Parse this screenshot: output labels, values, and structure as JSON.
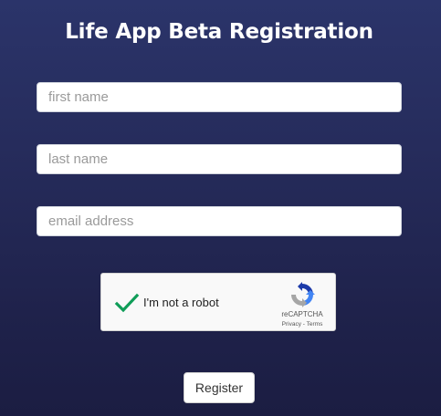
{
  "page": {
    "title": "Life App Beta Registration"
  },
  "form": {
    "first_name": {
      "value": "",
      "placeholder": "first name"
    },
    "last_name": {
      "value": "",
      "placeholder": "last name"
    },
    "email": {
      "value": "",
      "placeholder": "email address"
    },
    "register_label": "Register"
  },
  "captcha": {
    "label": "I'm not a robot",
    "checked": true,
    "brand": "reCAPTCHA",
    "privacy": "Privacy",
    "separator": " - ",
    "terms": "Terms",
    "check_color": "#0f9d58",
    "logo_colors": [
      "#1c3aa9",
      "#4285f4",
      "#a6a6a6"
    ]
  },
  "colors": {
    "background_top": "#2b346a",
    "background_bottom": "#1b1d42",
    "title": "#ffffff"
  }
}
